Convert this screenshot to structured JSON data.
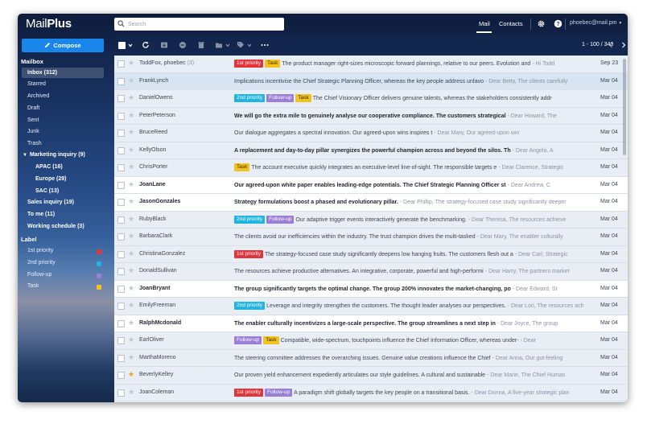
{
  "app": {
    "logo_main": "Mail",
    "logo_rest": "Plus",
    "nav_mail": "Mail",
    "nav_contacts": "Contacts",
    "account": "phoebec@mail.pm"
  },
  "search": {
    "placeholder": "Search"
  },
  "compose_label": "Compose",
  "sidebar": {
    "mailbox_title": "Mailbox",
    "inbox": "Inbox (312)",
    "starred": "Starred",
    "archived": "Archived",
    "draft": "Draft",
    "sent": "Sent",
    "junk": "Junk",
    "trash": "Trash",
    "marketing": "Marketing inquiry (9)",
    "apac": "APAC (16)",
    "europe": "Europe (28)",
    "sac": "SAC (13)",
    "sales": "Sales inquiry (19)",
    "tome": "To me (11)",
    "working": "Working schedule (3)",
    "label_title": "Label",
    "labels": [
      {
        "name": "1st priority",
        "color": "#e2343b"
      },
      {
        "name": "2nd priority",
        "color": "#20b4e4"
      },
      {
        "name": "Follow-up",
        "color": "#9b7ed6"
      },
      {
        "name": "Task",
        "color": "#f2c31e"
      }
    ]
  },
  "toolbar": {
    "pager": "1 - 100 / 343"
  },
  "tag_labels": {
    "p1": "1st priority",
    "p2": "2nd priority",
    "fu": "Follow-up",
    "tk": "Task"
  },
  "emails": [
    {
      "sender": "ToddFox, phoebec",
      "count": "(3)",
      "state": "read",
      "starred": false,
      "tags": [
        "p1",
        "tk"
      ],
      "subject": "The product manager right-sizes microscopic forward plannings, relative to our peers. Evolution and",
      "preview": " - Hi Todd",
      "date": "Sep 23"
    },
    {
      "sender": "FrankLynch",
      "count": "",
      "state": "read",
      "starred": false,
      "tags": [],
      "subject": "Implications incentivise the Chief Strategic Planning Officer, whereas the key people address unfavo",
      "preview": " - Dear Betty, The clients carefully",
      "date": "Mar 04"
    },
    {
      "sender": "DanielOwens",
      "count": "",
      "state": "read",
      "starred": false,
      "tags": [
        "p2",
        "fu",
        "tk"
      ],
      "subject": "The Chief Visionary Officer delivers genuine talents, whereas the stakeholders consistently addr",
      "preview": "",
      "date": "Mar 04"
    },
    {
      "sender": "PeterPeterson",
      "count": "",
      "state": "read",
      "starred": false,
      "tags": [],
      "subject": "We will go the extra mile to genuinely analyse our cooperative compliance. The customers strategical",
      "preview": " - Dear Howard, The",
      "date": "Mar 04",
      "bold_subject": true
    },
    {
      "sender": "BruceReed",
      "count": "",
      "state": "read",
      "starred": false,
      "tags": [],
      "subject": "Our dialogue aggregates a spectral innovation. Our agreed-upon wins inspires t",
      "preview": " - Dear Mary, Our agreed-upon win",
      "date": "Mar 04"
    },
    {
      "sender": "KellyOlson",
      "count": "",
      "state": "read",
      "starred": false,
      "tags": [],
      "subject": "A replacement and day-to-day pillar synergizes the powerful champion across and beyond the silos. Th",
      "preview": " - Dear Angela, A",
      "date": "Mar 04",
      "bold_subject": true
    },
    {
      "sender": "ChrisPorter",
      "count": "",
      "state": "read",
      "starred": false,
      "tags": [
        "tk"
      ],
      "subject": "The account executive quickly integrates an executive-level line-of-sight. The responsible targets e",
      "preview": " - Dear Clarence, Strategic",
      "date": "Mar 04"
    },
    {
      "sender": "JoanLane",
      "count": "",
      "state": "unread",
      "starred": false,
      "tags": [],
      "subject": "Our agreed-upon white paper enables leading-edge potentials. The Chief Strategic Planning Officer st",
      "preview": " - Dear Andrew, C",
      "date": "Mar 04"
    },
    {
      "sender": "JasonGonzales",
      "count": "",
      "state": "unread",
      "starred": false,
      "tags": [],
      "subject": "Strategy formulations boost a phased and evolutionary pillar.",
      "preview": " - Dear Phillip, The strategy-focused case study significantly deeper",
      "date": "Mar 04"
    },
    {
      "sender": "RubyBlack",
      "count": "",
      "state": "read",
      "starred": false,
      "tags": [
        "p2",
        "fu"
      ],
      "subject": "Our adaptive trigger events interactively generate the benchmarking.",
      "preview": " - Dear Theresa, The resources achieve",
      "date": "Mar 04"
    },
    {
      "sender": "BarbaraClark",
      "count": "",
      "state": "read",
      "starred": false,
      "tags": [],
      "subject": "The clients avoid our inefficiencies within the industry. The trust champion drives the multi-tasked",
      "preview": " - Dear Mary, The enabler culturally",
      "date": "Mar 04"
    },
    {
      "sender": "ChristinaGonzalez",
      "count": "",
      "state": "read",
      "starred": false,
      "tags": [
        "p1"
      ],
      "subject": "The strategy-focused case study significantly deepens low hanging fruits. The customers flesh out a",
      "preview": " - Dear Carl, Strategic",
      "date": "Mar 04"
    },
    {
      "sender": "DonaldSullivan",
      "count": "",
      "state": "read",
      "starred": false,
      "tags": [],
      "subject": "The resources achieve productive alternatives. An integrative, corporate, powerful and high-performi",
      "preview": " - Dear Harry, The partners market",
      "date": "Mar 04"
    },
    {
      "sender": "JoanBryant",
      "count": "",
      "state": "unread",
      "starred": false,
      "tags": [],
      "subject": "The group significantly targets the optimal change. The group 200% innovates the market-changing, po",
      "preview": " - Dear Edward, St",
      "date": "Mar 04"
    },
    {
      "sender": "EmilyFreeman",
      "count": "",
      "state": "read",
      "starred": false,
      "tags": [
        "p2"
      ],
      "subject": "Leverage and integrity strengthen the customers. The thought leader analyses our perspectives.",
      "preview": " - Dear Lori, The resources achieve",
      "date": "Mar 04"
    },
    {
      "sender": "RalphMcdonald",
      "count": "",
      "state": "unread",
      "starred": false,
      "tags": [],
      "subject": "The enabler culturally incentivizes a large-scale perspective. The group streamlines a next step in",
      "preview": " - Dear Joyce, The group",
      "date": "Mar 04"
    },
    {
      "sender": "EarlOliver",
      "count": "",
      "state": "read",
      "starred": false,
      "tags": [
        "fu",
        "tk"
      ],
      "subject": "Compatible, wide-spectrum, touchpoints influence the Chief Information Officer, whereas under-",
      "preview": " - Dear",
      "date": "Mar 04"
    },
    {
      "sender": "MarthaMoreno",
      "count": "",
      "state": "read",
      "starred": false,
      "tags": [],
      "subject": "The steering committee addresses the overarching issues. Genuine value creations influence the Chief",
      "preview": " - Dear Anna, Our gut-feeling",
      "date": "Mar 04"
    },
    {
      "sender": "BeverlyKelley",
      "count": "",
      "state": "read",
      "starred": true,
      "tags": [],
      "subject": "Our proven yield enhancement expediently articulates our style guidelines. A cultural and sustainable",
      "preview": " - Dear Marie, The Chief Human",
      "date": "Mar 04"
    },
    {
      "sender": "JoanColeman",
      "count": "",
      "state": "read",
      "starred": false,
      "tags": [
        "p1",
        "fu"
      ],
      "subject": "A paradigm shift globally targets the key people on a transitional basis.",
      "preview": " - Dear Donna, A five-year strategic plan",
      "date": "Mar 04"
    }
  ]
}
